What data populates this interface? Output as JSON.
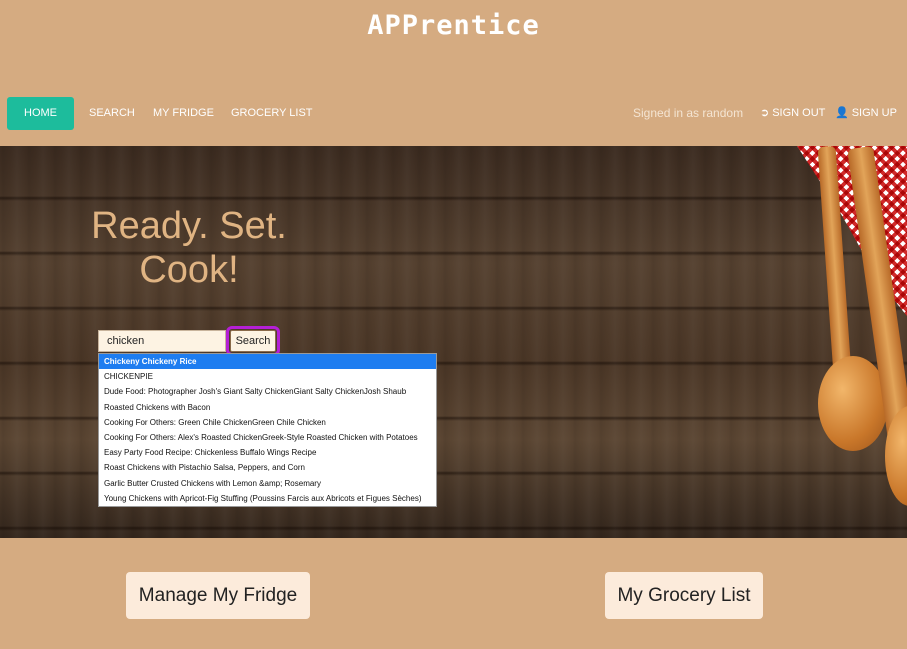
{
  "app": {
    "title": "APPrentice"
  },
  "nav": {
    "items": [
      {
        "label": "HOME"
      },
      {
        "label": "SEARCH"
      },
      {
        "label": "MY FRIDGE"
      },
      {
        "label": "GROCERY LIST"
      }
    ],
    "signed_in_text": "Signed in as random",
    "sign_out_label": "SIGN OUT",
    "sign_up_label": "SIGN UP"
  },
  "hero": {
    "headline_line1": "Ready. Set.",
    "headline_line2": "Cook!"
  },
  "search": {
    "value": "chicken",
    "button_label": "Search",
    "suggestions": [
      "Chickeny Chickeny Rice",
      "CHICKENPIE",
      "Dude Food: Photographer Josh's Giant Salty ChickenGiant Salty ChickenJosh Shaub",
      "Roasted Chickens with Bacon",
      "Cooking For Others: Green Chile ChickenGreen Chile Chicken",
      "Cooking For Others: Alex's Roasted ChickenGreek-Style Roasted Chicken with Potatoes",
      "Easy Party Food Recipe: Chickenless Buffalo Wings Recipe",
      "Roast Chickens with Pistachio Salsa, Peppers, and Corn",
      "Garlic Butter Crusted Chickens with Lemon &amp; Rosemary",
      "Young Chickens with Apricot-Fig Stuffing (Poussins Farcis aux Abricots et Figues Sèches)"
    ],
    "active_index": 0
  },
  "actions": {
    "manage_fridge_label": "Manage My Fridge",
    "grocery_list_label": "My Grocery List"
  },
  "colors": {
    "background": "#d5ab81",
    "nav_active": "#1dbc9c",
    "highlight_outline": "#b41fd6",
    "suggestion_active": "#1e7df0",
    "button_bg": "#fcebdb"
  }
}
